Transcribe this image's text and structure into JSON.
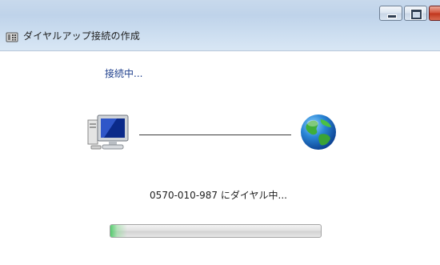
{
  "window": {
    "title": "ダイヤルアップ接続の作成",
    "caption_buttons": [
      "minimize",
      "maximize",
      "close"
    ]
  },
  "status": {
    "text": "接続中..."
  },
  "dial": {
    "message": "0570-010-987 にダイヤル中..."
  },
  "progress": {
    "fraction": 0.08
  },
  "icons": {
    "title": "phone-dialer-icon",
    "left": "computer-icon",
    "right": "globe-icon"
  },
  "colors": {
    "status_text": "#1e3f8c",
    "progress_fill": "#3cc85a",
    "header_bg": "#c8d9ec"
  }
}
